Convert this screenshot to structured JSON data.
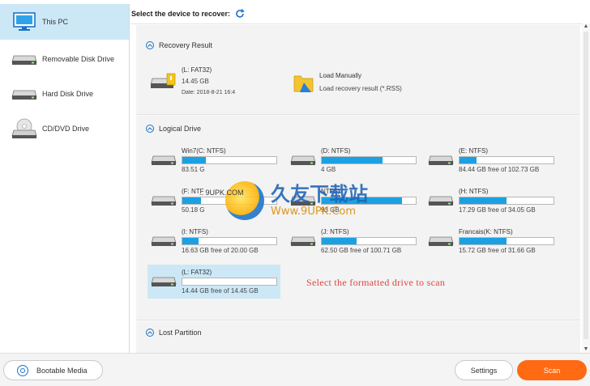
{
  "sidebar": {
    "items": [
      {
        "label": "This PC",
        "icon": "monitor-icon",
        "active": true
      },
      {
        "label": "Removable Disk Drive",
        "icon": "removable-disk-icon",
        "active": false
      },
      {
        "label": "Hard Disk Drive",
        "icon": "hard-disk-icon",
        "active": false
      },
      {
        "label": "CD/DVD Drive",
        "icon": "cd-dvd-icon",
        "active": false
      }
    ]
  },
  "header": {
    "title": "Select the device to recover:",
    "refresh_icon": "refresh-icon"
  },
  "recovery_result": {
    "heading": "Recovery Result",
    "drive": {
      "name": "(L: FAT32)",
      "size": "14.45 GB",
      "date": "Date: 2018-8-21 16:4"
    },
    "load_manually": {
      "title": "Load Manually",
      "subtitle": "Load recovery result (*.RSS)"
    }
  },
  "logical_drive": {
    "heading": "Logical Drive",
    "drives": [
      {
        "name": "Win7(C: NTFS)",
        "free": "83.51 G",
        "used_fraction": 0.25
      },
      {
        "name": "(D: NTFS)",
        "free": "4 GB",
        "used_fraction": 0.65
      },
      {
        "name": "(E: NTFS)",
        "free": "84.44 GB free of 102.73 GB",
        "used_fraction": 0.18
      },
      {
        "name": "(F: NTF",
        "free": "50.18 G",
        "used_fraction": 0.2
      },
      {
        "name": "NTFS)",
        "free": "93 GB",
        "used_fraction": 0.85
      },
      {
        "name": "(H: NTFS)",
        "free": "17.29 GB free of 34.05 GB",
        "used_fraction": 0.5
      },
      {
        "name": "(I: NTFS)",
        "free": "16.63 GB free of 20.00 GB",
        "used_fraction": 0.17
      },
      {
        "name": "(J: NTFS)",
        "free": "62.50 GB free of 100.71 GB",
        "used_fraction": 0.37
      },
      {
        "name": "Francais(K: NTFS)",
        "free": "15.72 GB free of 31.66 GB",
        "used_fraction": 0.5
      },
      {
        "name": "(L: FAT32)",
        "free": "14.44 GB free of 14.45 GB",
        "used_fraction": 0.0,
        "selected": true
      }
    ]
  },
  "hint": "Select the formatted drive to scan",
  "lost_partition": {
    "heading": "Lost Partition"
  },
  "watermark": {
    "cn": "久友下载站",
    "url": "Www.9UPK.Com",
    "small": ".. 9UPK.COM"
  },
  "footer": {
    "bootable_media": "Bootable Media",
    "settings": "Settings",
    "scan": "Scan"
  },
  "colors": {
    "accent": "#1ba1e2",
    "selected_bg": "#cce8f6",
    "scan": "#ff6a13",
    "hint": "#e24444"
  }
}
